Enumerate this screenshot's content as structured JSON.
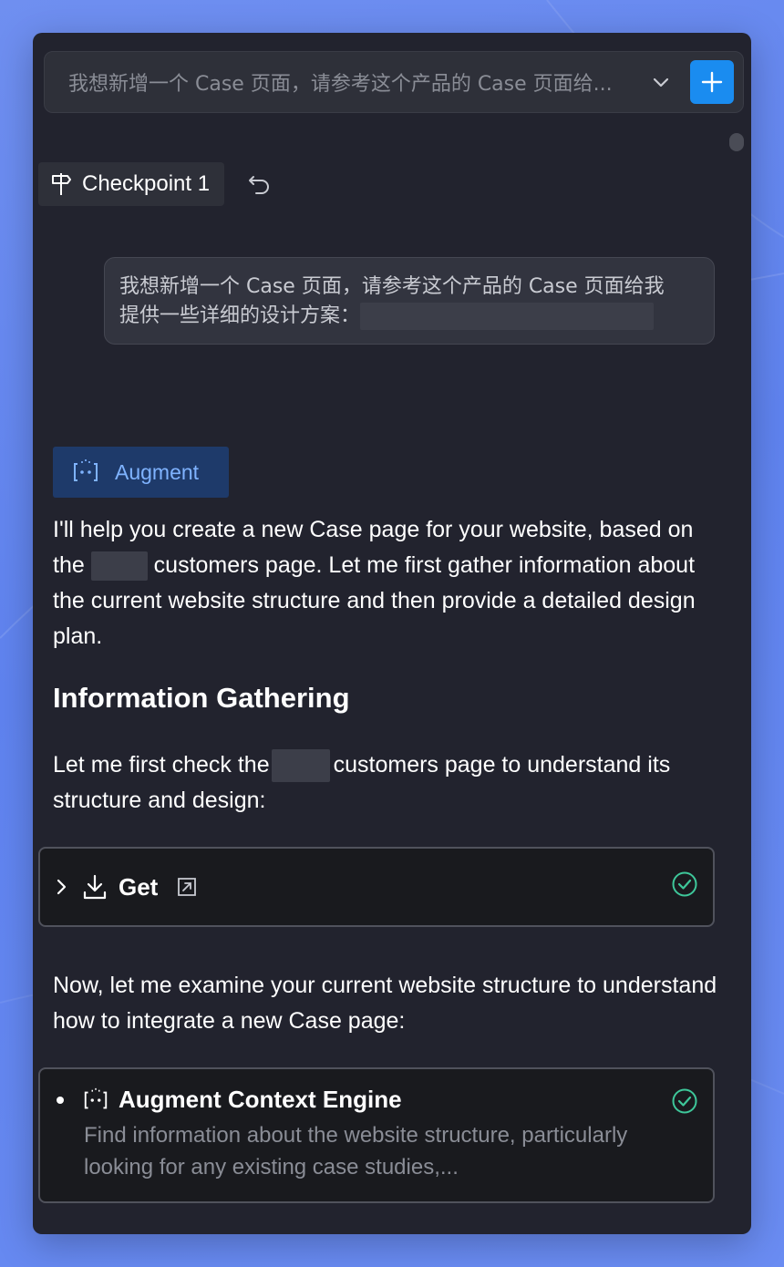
{
  "colors": {
    "accent": "#1a8cf0",
    "augment_text": "#7fb3ff",
    "success": "#3ec79a",
    "panel_bg": "#22232e"
  },
  "topbar": {
    "title": "我想新增一个 Case 页面，请参考这个产品的 Case 页面给...",
    "dropdown_icon": "chevron-down-icon",
    "add_icon": "plus-icon"
  },
  "checkpoint": {
    "label": "Checkpoint 1",
    "icon": "signpost-icon",
    "revert_icon": "undo-icon"
  },
  "user_message": {
    "line1": "我想新增一个 Case 页面，请参考这个产品的 Case 页面给我",
    "line2": "提供一些详细的设计方案："
  },
  "assistant": {
    "name": "Augment",
    "intro_part1": "I'll help you create a new Case page for your website, based on the",
    "intro_part2": "customers page. Let me first gather information about the current website structure and then provide a detailed design plan.",
    "heading": "Information Gathering",
    "check_part1": "Let me first check the",
    "check_part2": "customers page to understand its structure and design:",
    "examine_text": "Now, let me examine your current website structure to understand how to integrate a new Case page:"
  },
  "tool_get": {
    "label": "Get",
    "status": "success"
  },
  "tool_engine": {
    "title": "Augment Context Engine",
    "description": "Find information about the website structure, particularly looking for any existing case studies,...",
    "status": "success"
  }
}
